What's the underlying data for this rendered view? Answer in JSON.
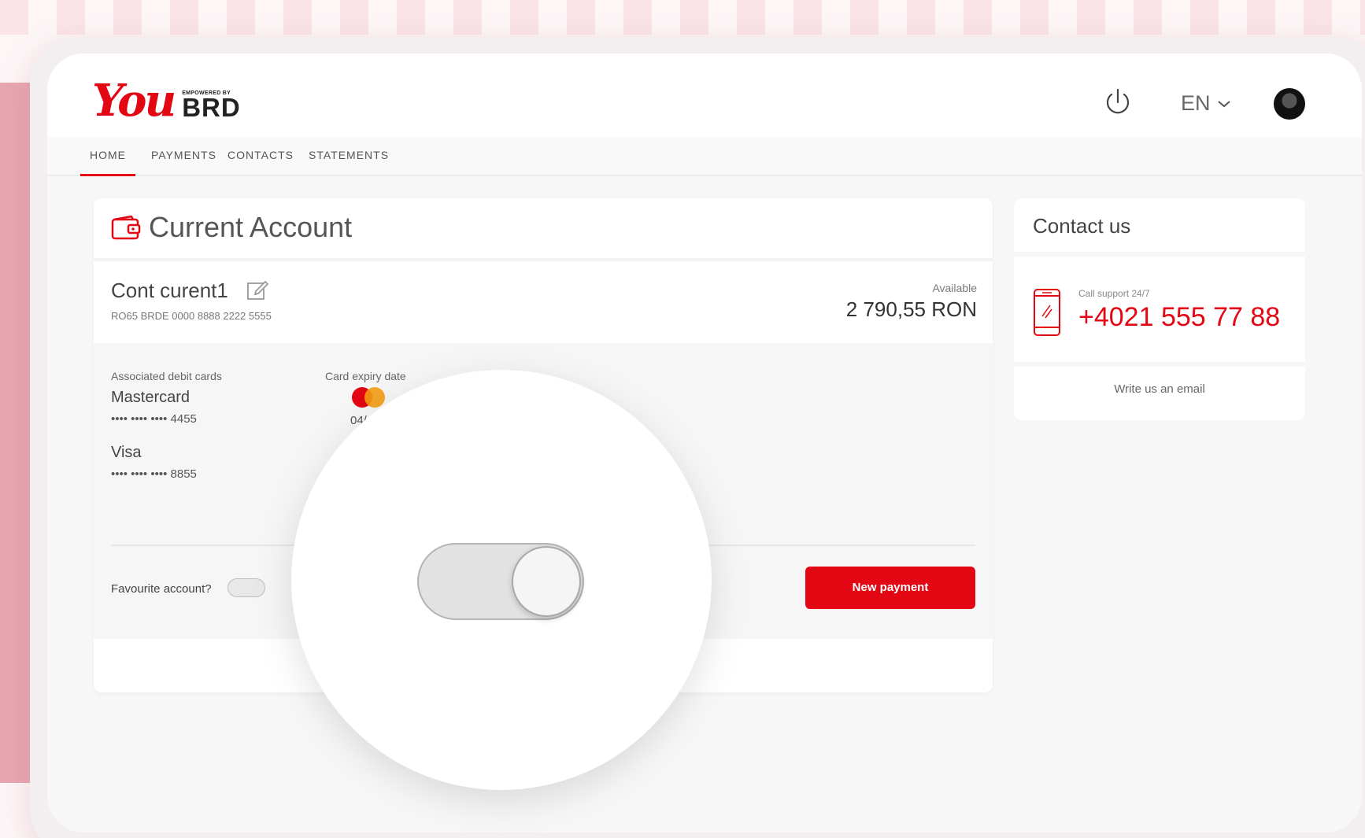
{
  "brand": {
    "logo_main": "You",
    "logo_tag": "EMPOWERED BY",
    "logo_bank": "BRD",
    "accent_color": "#e30613"
  },
  "header": {
    "power_icon": "power-icon",
    "language": "EN",
    "language_icon": "chevron-down-icon",
    "avatar_icon": "user-avatar"
  },
  "nav": {
    "items": [
      {
        "label": "HOME",
        "active": true
      },
      {
        "label": "PAYMENTS",
        "active": false
      },
      {
        "label": "CONTACTS",
        "active": false
      },
      {
        "label": "STATEMENTS",
        "active": false
      }
    ]
  },
  "account_card": {
    "icon": "wallet-icon",
    "title": "Current Account",
    "account_name": "Cont curent1",
    "edit_icon": "edit-icon",
    "iban": "RO65 BRDE 0000 8888 2222 5555",
    "available_label": "Available",
    "available_amount": "2 790,55 RON",
    "debit_cards_label": "Associated debit cards",
    "expiry_label": "Card expiry date",
    "cards": [
      {
        "name": "Mastercard",
        "number": "•••• •••• •••• 4455",
        "expiry_partial": "04/"
      },
      {
        "name": "Visa",
        "number": "•••• •••• •••• 8855"
      }
    ],
    "favourite_label": "Favourite account?",
    "favourite_on": false,
    "new_payment_label": "New payment"
  },
  "contact_card": {
    "title": "Contact us",
    "phone_icon": "phone-icon",
    "call_label": "Call support 24/7",
    "phone_number": "+4021 555 77 88",
    "email_link": "Write us an email"
  },
  "magnifier": {
    "toggle_on": true
  }
}
